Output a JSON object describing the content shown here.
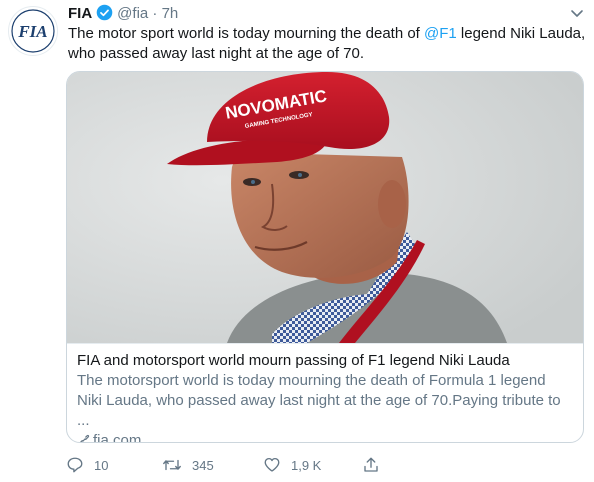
{
  "tweet": {
    "author_name": "FIA",
    "handle": "@fia",
    "separator": "·",
    "time": "7h",
    "text_before": "The motor sport world is today mourning the death of ",
    "mention": "@F1",
    "text_after": " legend Niki Lauda, who passed away last night at the age of 70.",
    "avatar_logo_text": "FIA"
  },
  "card": {
    "title": "FIA and motorsport world mourn passing of F1 legend Niki Lauda",
    "description": "The motorsport world is today mourning the death of Formula 1 legend Niki Lauda, who passed away last night at the age of 70.Paying tribute to ...",
    "domain": "fia.com",
    "cap_text": "NOVOMATIC",
    "cap_subtext": "GAMING TECHNOLOGY"
  },
  "actions": {
    "reply_count": "10",
    "retweet_count": "345",
    "like_count": "1,9 K"
  },
  "colors": {
    "link": "#1da1f2",
    "muted": "#657786",
    "cap_red": "#c8102e"
  }
}
